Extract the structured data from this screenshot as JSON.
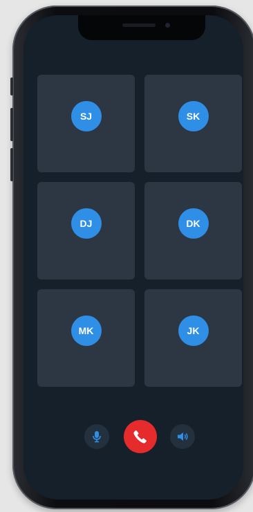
{
  "call": {
    "participants": [
      {
        "initials": "SJ"
      },
      {
        "initials": "SK"
      },
      {
        "initials": "DJ"
      },
      {
        "initials": "DK"
      },
      {
        "initials": "MK"
      },
      {
        "initials": "JK"
      }
    ],
    "controls": {
      "mute_icon": "microphone-icon",
      "end_call_icon": "phone-hangup-icon",
      "speaker_icon": "speaker-icon"
    }
  },
  "colors": {
    "screen_bg": "#16202b",
    "tile_bg": "#2d3743",
    "avatar_bg": "#2f8ee6",
    "end_call": "#e52b2b",
    "control_bg": "#23303d",
    "icon_blue": "#2f8ee6"
  }
}
